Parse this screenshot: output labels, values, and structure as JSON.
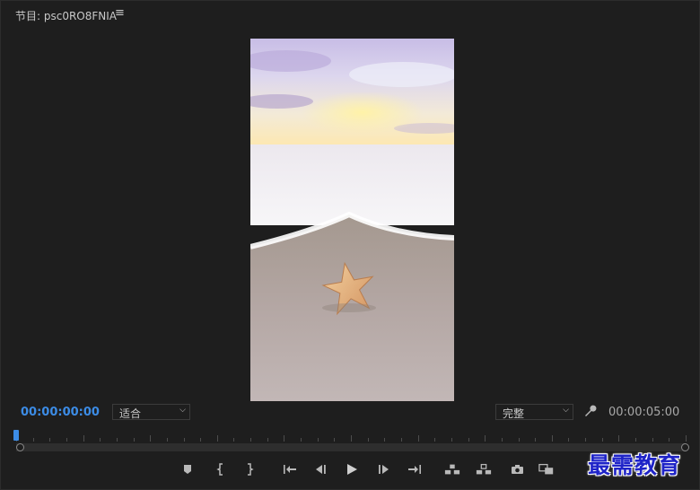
{
  "panel": {
    "title": "节目: psc0RO8FNIA",
    "menu_icon": "hamburger-menu-icon"
  },
  "monitor": {
    "image": "starfish-on-beach-vertical-frame"
  },
  "timecode": {
    "current": "00:00:00:00",
    "duration": "00:00:05:00",
    "current_color": "#3c8ce6"
  },
  "dropdowns": {
    "fit": "适合",
    "resolution": "完整"
  },
  "transport": {
    "buttons": [
      "add-marker-icon",
      "mark-in-icon",
      "mark-out-icon",
      "go-to-in-icon",
      "step-back-icon",
      "play-icon",
      "step-forward-icon",
      "go-to-out-icon",
      "lift-icon",
      "extract-icon",
      "export-frame-icon",
      "comparison-view-icon"
    ]
  },
  "watermark": {
    "text": "最需教育"
  }
}
